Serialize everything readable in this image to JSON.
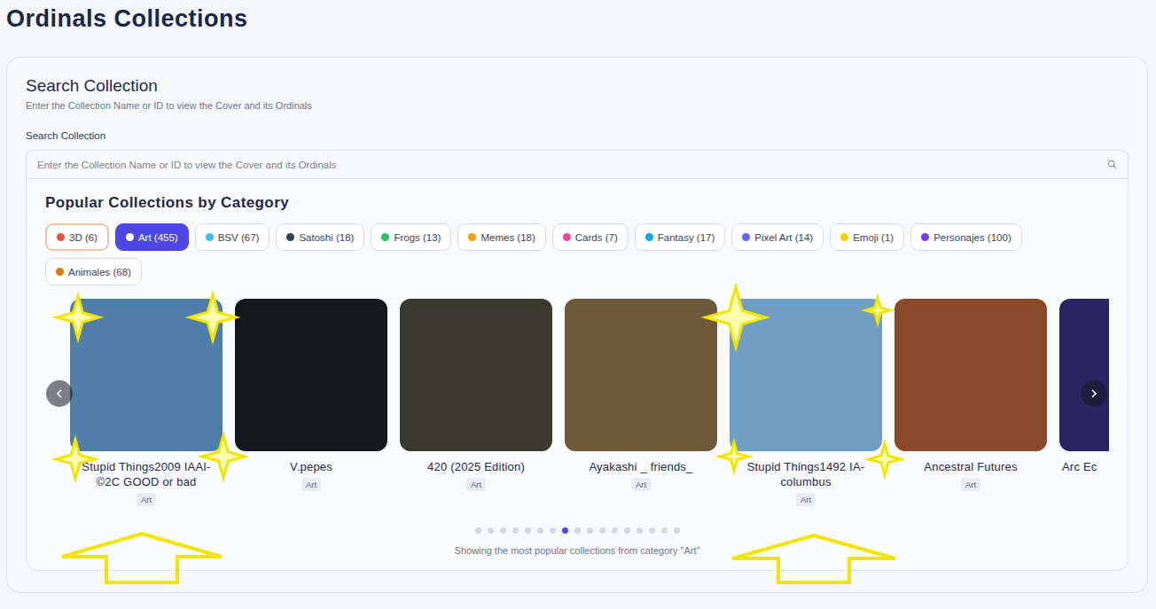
{
  "page": {
    "title": "Ordinals Collections"
  },
  "search": {
    "heading": "Search Collection",
    "subtitle": "Enter the Collection Name or ID to view the Cover and its Ordinals",
    "label": "Search Collection",
    "placeholder": "Enter the Collection Name or ID to view the Cover and its Ordinals"
  },
  "popular": {
    "heading": "Popular Collections by Category",
    "tabs": [
      {
        "label": "3D (6)",
        "selected": false,
        "focused": true
      },
      {
        "label": "Art (455)",
        "selected": true,
        "focused": false
      },
      {
        "label": "BSV (67)",
        "selected": false,
        "focused": false
      },
      {
        "label": "Satoshi (18)",
        "selected": false,
        "focused": false
      },
      {
        "label": "Frogs (13)",
        "selected": false,
        "focused": false
      },
      {
        "label": "Memes (18)",
        "selected": false,
        "focused": false
      },
      {
        "label": "Cards (7)",
        "selected": false,
        "focused": false
      },
      {
        "label": "Fantasy (17)",
        "selected": false,
        "focused": false
      },
      {
        "label": "Pixel Art (14)",
        "selected": false,
        "focused": false
      },
      {
        "label": "Emoji (1)",
        "selected": false,
        "focused": false
      },
      {
        "label": "Personajes (100)",
        "selected": false,
        "focused": false
      },
      {
        "label": "Animales (68)",
        "selected": false,
        "focused": false
      }
    ],
    "collections": [
      {
        "name": "Stupid Things2009 IAAI-©2C GOOD or bad",
        "tag": "Art",
        "kind": "full",
        "color": "#4f7fa8"
      },
      {
        "name": "V.pepes",
        "tag": "Art",
        "kind": "full",
        "color": "#16181c"
      },
      {
        "name": "420 (2025 Edition)",
        "tag": "Art",
        "kind": "full",
        "color": "#3a3a30"
      },
      {
        "name": "Ayakashi _ friends_",
        "tag": "Art",
        "kind": "full",
        "color": "#6e5a3a"
      },
      {
        "name": "Stupid Things1492 IA-columbus",
        "tag": "Art",
        "kind": "full",
        "color": "#6f9fc4"
      },
      {
        "name": "Ancestral Futures",
        "tag": "Art",
        "kind": "full",
        "color": "#8a4a2a"
      },
      {
        "name": "Arc Ec",
        "tag": "",
        "kind": "partial",
        "color": "#2a2560"
      }
    ],
    "dots": [
      {
        "selected": false
      },
      {
        "selected": false
      },
      {
        "selected": false
      },
      {
        "selected": false
      },
      {
        "selected": false
      },
      {
        "selected": false
      },
      {
        "selected": false
      },
      {
        "selected": true
      },
      {
        "selected": false
      },
      {
        "selected": false
      },
      {
        "selected": false
      },
      {
        "selected": false
      },
      {
        "selected": false
      },
      {
        "selected": false
      },
      {
        "selected": false
      },
      {
        "selected": false
      },
      {
        "selected": false
      }
    ],
    "caption": "Showing the most popular collections from category \"Art\""
  }
}
